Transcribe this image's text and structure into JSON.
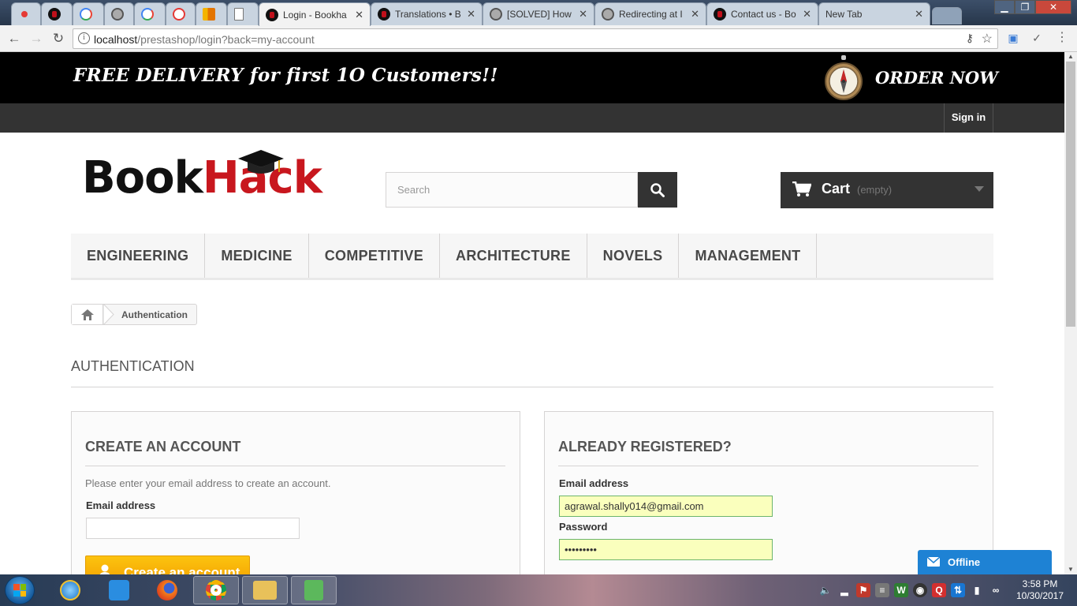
{
  "browser": {
    "tabs": [
      {
        "label": "",
        "icon": "record-icon"
      },
      {
        "label": "",
        "icon": "bookhack-favicon-icon"
      },
      {
        "label": "",
        "icon": "google-icon"
      },
      {
        "label": "",
        "icon": "spiral-icon"
      },
      {
        "label": "",
        "icon": "google-icon"
      },
      {
        "label": "",
        "icon": "ie-icon"
      },
      {
        "label": "",
        "icon": "analytics-icon"
      },
      {
        "label": "",
        "icon": "document-icon"
      },
      {
        "label": "Login - Bookha",
        "icon": "bookhack-favicon-icon",
        "active": true
      },
      {
        "label": "Translations • B",
        "icon": "bookhack-favicon-icon"
      },
      {
        "label": "[SOLVED] How",
        "icon": "spiral-icon"
      },
      {
        "label": "Redirecting at I",
        "icon": "spiral-icon"
      },
      {
        "label": "Contact us - Bo",
        "icon": "bookhack-favicon-icon"
      },
      {
        "label": "New Tab",
        "icon": ""
      }
    ],
    "url_host": "localhost",
    "url_path": "/prestashop/login?back=my-account"
  },
  "banner": {
    "promo": "FREE DELIVERY for first 1O Customers!!",
    "order_now": "ORDER NOW"
  },
  "header": {
    "sign_in": "Sign in",
    "logo_part1": "Boo",
    "logo_part2": "k",
    "logo_part3": "Hack",
    "search_placeholder": "Search",
    "cart_label": "Cart",
    "cart_status": "(empty)"
  },
  "menu": {
    "items": [
      "ENGINEERING",
      "MEDICINE",
      "COMPETITIVE",
      "ARCHITECTURE",
      "NOVELS",
      "MANAGEMENT"
    ]
  },
  "breadcrumb": {
    "current": "Authentication"
  },
  "page": {
    "heading": "AUTHENTICATION"
  },
  "create_account": {
    "title": "CREATE AN ACCOUNT",
    "intro": "Please enter your email address to create an account.",
    "email_label": "Email address",
    "email_value": "",
    "button": "Create an account"
  },
  "login": {
    "title": "ALREADY REGISTERED?",
    "email_label": "Email address",
    "email_value": "agrawal.shally014@gmail.com",
    "password_label": "Password",
    "password_value": "•••••••••"
  },
  "chat": {
    "status": "Offline"
  },
  "taskbar": {
    "time": "3:58 PM",
    "date": "10/30/2017"
  },
  "colors": {
    "accent_button": "#f7b400",
    "header_dark": "#333333",
    "logo_red": "#c8171e",
    "chat_blue": "#1e82d4",
    "autofill": "#faffbd"
  }
}
